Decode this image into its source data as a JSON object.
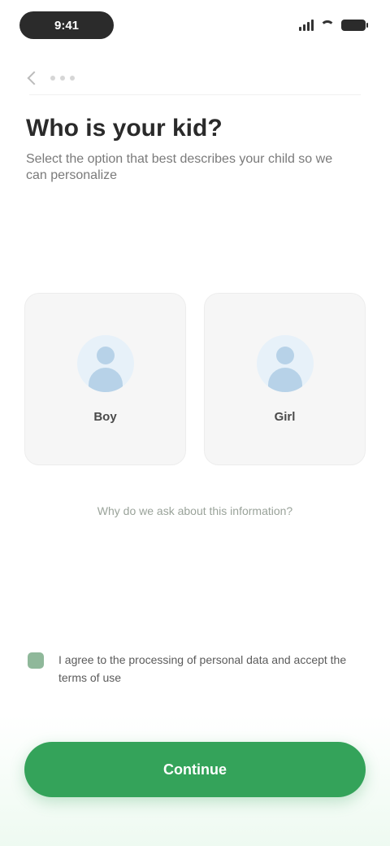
{
  "status_bar": {
    "time": "9:41"
  },
  "header": {
    "title": "Who is your kid?",
    "subtitle": "Select the option that best describes your child so we can personalize"
  },
  "options": [
    {
      "label": "Boy",
      "icon": "boy-avatar-icon"
    },
    {
      "label": "Girl",
      "icon": "girl-avatar-icon"
    }
  ],
  "help_link": "Why do we ask about this information?",
  "consent": {
    "text": "I agree to the processing of personal data and accept the terms of use"
  },
  "footer": {
    "continue_label": "Continue"
  },
  "colors": {
    "accent_green": "#34a35a",
    "card_bg": "#f6f6f6",
    "avatar_bg": "#e7f1f9"
  }
}
